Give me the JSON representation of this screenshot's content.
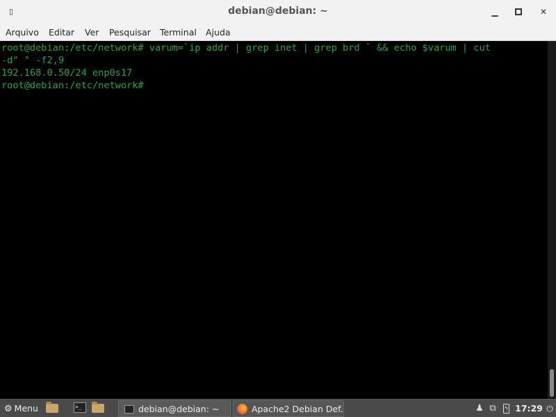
{
  "window": {
    "title": "debian@debian: ~"
  },
  "menubar": {
    "items": [
      "Arquivo",
      "Editar",
      "Ver",
      "Pesquisar",
      "Terminal",
      "Ajuda"
    ]
  },
  "terminal": {
    "lines": [
      "root@debian:/etc/network# varum=`ip addr | grep inet | grep brd ` && echo $varum | cut",
      "-d\" \" -f2,9",
      "192.168.0.50/24 enp0s17",
      "root@debian:/etc/network# "
    ],
    "text_color": "#29a33a"
  },
  "taskbar": {
    "menu_label": "Menu",
    "tasks": [
      {
        "label": "debian@debian: ~"
      },
      {
        "label": "Apache2 Debian Def..."
      }
    ],
    "clock": "17:29"
  }
}
